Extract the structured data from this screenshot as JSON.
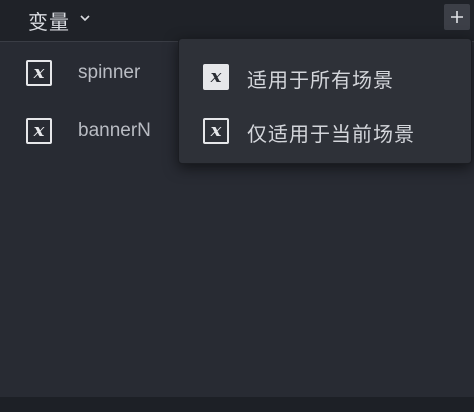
{
  "header": {
    "title": "变量",
    "chevron_icon": "chevron-down-icon",
    "add_icon": "plus-icon"
  },
  "variables": [
    {
      "name": "spinner",
      "icon": "variable-x-icon"
    },
    {
      "name": "bannerN",
      "icon": "variable-x-icon"
    }
  ],
  "dropdown": {
    "items": [
      {
        "label": "适用于所有场景",
        "icon": "variable-x-icon",
        "highlighted": true
      },
      {
        "label": "仅适用于当前场景",
        "icon": "variable-x-icon",
        "highlighted": false
      }
    ]
  },
  "icon_glyph": "x",
  "colors": {
    "panel_bg": "#282b33",
    "header_bg": "#1f2228",
    "menu_bg": "#2e3138",
    "text": "#d4d6db"
  }
}
